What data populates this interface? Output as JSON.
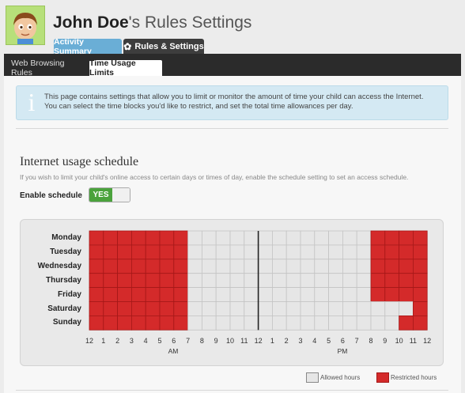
{
  "header": {
    "user_name": "John Doe",
    "title_suffix": "'s Rules Settings",
    "tabs": [
      {
        "label": "Activity Summary"
      },
      {
        "label": "Rules & Settings"
      }
    ]
  },
  "subtabs": [
    {
      "label": "Web Browsing Rules"
    },
    {
      "label": "Time Usage Limits"
    }
  ],
  "info": {
    "icon": "info-icon",
    "text_line1": "This page contains settings that allow you to limit or monitor the amount of time your child can access the Internet.",
    "text_line2": "You can select the time blocks you'd like to restrict, and set the total time allowances per day."
  },
  "schedule": {
    "title": "Internet usage schedule",
    "description": "If you wish to limit your child's online access to certain days or times of day, enable the schedule setting to set an access schedule.",
    "enable_label": "Enable schedule",
    "toggle_label": "YES",
    "toggle_on": true,
    "days": [
      "Monday",
      "Tuesday",
      "Wednesday",
      "Thursday",
      "Friday",
      "Saturday",
      "Sunday"
    ],
    "hour_labels": [
      "12",
      "1",
      "2",
      "3",
      "4",
      "5",
      "6",
      "7",
      "8",
      "9",
      "10",
      "11",
      "12",
      "1",
      "2",
      "3",
      "4",
      "5",
      "6",
      "7",
      "8",
      "9",
      "10",
      "11",
      "12"
    ],
    "am_label": "AM",
    "pm_label": "PM",
    "restricted_hours": {
      "Monday": [
        0,
        1,
        2,
        3,
        4,
        5,
        6,
        20,
        21,
        22,
        23
      ],
      "Tuesday": [
        0,
        1,
        2,
        3,
        4,
        5,
        6,
        20,
        21,
        22,
        23
      ],
      "Wednesday": [
        0,
        1,
        2,
        3,
        4,
        5,
        6,
        20,
        21,
        22,
        23
      ],
      "Thursday": [
        0,
        1,
        2,
        3,
        4,
        5,
        6,
        20,
        21,
        22,
        23
      ],
      "Friday": [
        0,
        1,
        2,
        3,
        4,
        5,
        6,
        20,
        21,
        22,
        23
      ],
      "Saturday": [
        0,
        1,
        2,
        3,
        4,
        5,
        6,
        23
      ],
      "Sunday": [
        0,
        1,
        2,
        3,
        4,
        5,
        6,
        22,
        23
      ]
    }
  },
  "legend": {
    "allowed_label": "Allowed hours",
    "restricted_label": "Restricted hours",
    "allowed_color": "#e6e6e6",
    "restricted_color": "#d42a2a"
  }
}
